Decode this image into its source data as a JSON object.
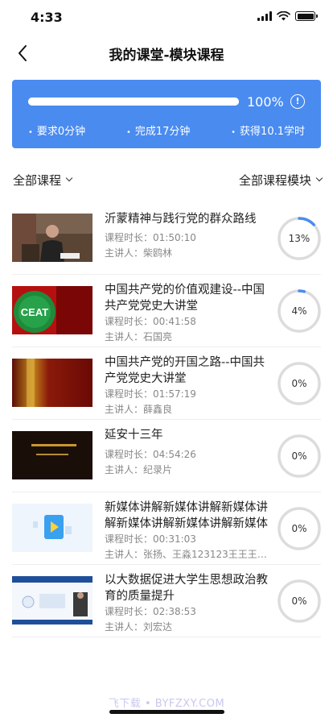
{
  "status_bar": {
    "time": "4:33"
  },
  "header": {
    "title": "我的课堂-模块课程"
  },
  "progress_card": {
    "progress_percent_value": 100,
    "progress_label": "100%",
    "stats": [
      "要求0分钟",
      "完成17分钟",
      "获得10.1学时"
    ]
  },
  "filters": {
    "left": "全部课程",
    "right": "全部课程模块"
  },
  "courses": [
    {
      "title": "沂蒙精神与践行党的群众路线",
      "duration": "课程时长：01:50:10",
      "speaker": "主讲人：柴鸥林",
      "progress_value": 13,
      "progress_label": "13%",
      "thumb_caption": "柴鸥林"
    },
    {
      "title": "中国共产党的价值观建设--中国共产党党史大讲堂",
      "duration": "课程时长：00:41:58",
      "speaker": "主讲人：石国亮",
      "progress_value": 4,
      "progress_label": "4%",
      "thumb_caption": "CEAT"
    },
    {
      "title": "中国共产党的开国之路--中国共产党党史大讲堂",
      "duration": "课程时长：01:57:19",
      "speaker": "主讲人：薛鑫良",
      "progress_value": 0,
      "progress_label": "0%"
    },
    {
      "title": "延安十三年",
      "duration": "课程时长：04:54:26",
      "speaker": "主讲人：纪录片",
      "progress_value": 0,
      "progress_label": "0%"
    },
    {
      "title": "新媒体讲解新媒体讲解新媒体讲解新媒体讲解新媒体讲解新媒体讲解",
      "duration": "课程时长：00:31:03",
      "speaker": "主讲人：张扬、王淼123123王王王王王",
      "progress_value": 0,
      "progress_label": "0%"
    },
    {
      "title": "以大数据促进大学生思想政治教育的质量提升",
      "duration": "课程时长：02:38:53",
      "speaker": "主讲人：刘宏达",
      "progress_value": 0,
      "progress_label": "0%"
    }
  ],
  "watermark": "飞下载 • BYFZXY.COM",
  "colors": {
    "accent": "#4a8bf0",
    "ring_track": "#dcdcdc",
    "ring_progress": "#4a8bf0"
  }
}
